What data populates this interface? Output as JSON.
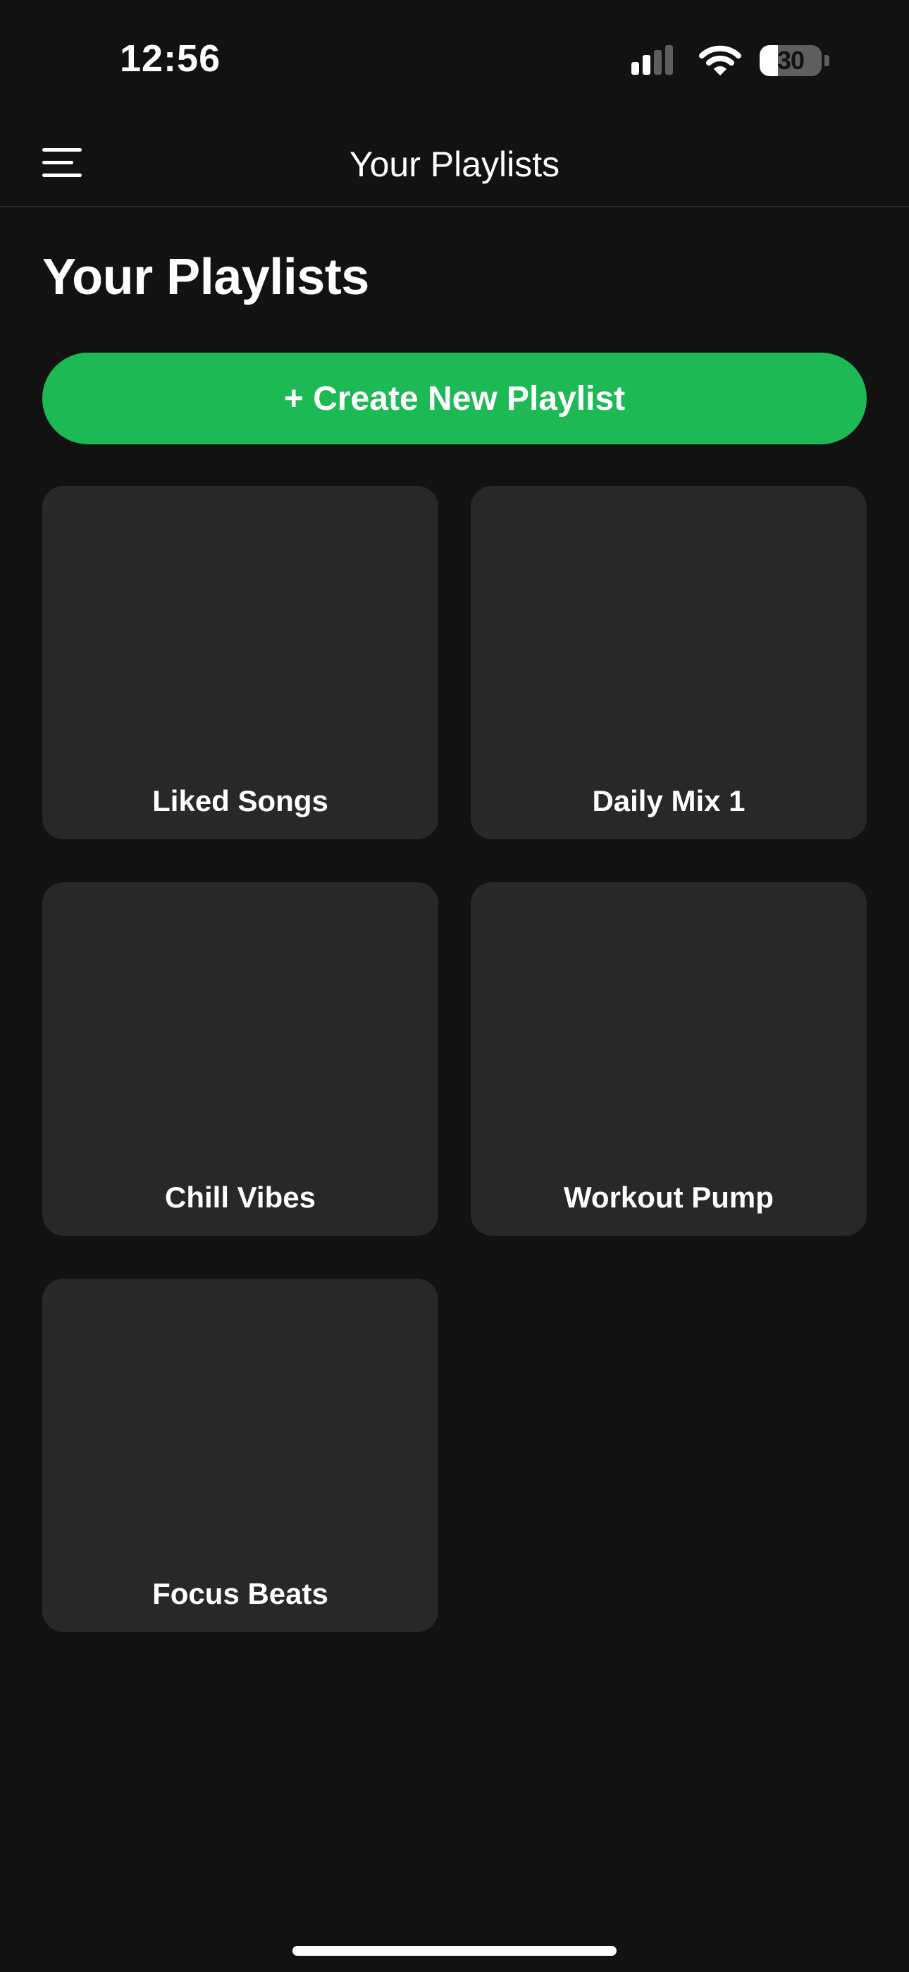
{
  "status_bar": {
    "time": "12:56",
    "battery_level": "30",
    "battery_fraction": 0.3,
    "icons": [
      "signal-icon",
      "wifi-icon",
      "battery-icon"
    ]
  },
  "nav": {
    "title": "Your Playlists",
    "menu_icon": "hamburger-menu-icon"
  },
  "main": {
    "heading": "Your Playlists",
    "create_button_label": "+ Create New Playlist",
    "playlists": [
      {
        "name": "Liked Songs"
      },
      {
        "name": "Daily Mix 1"
      },
      {
        "name": "Chill Vibes"
      },
      {
        "name": "Workout Pump"
      },
      {
        "name": "Focus Beats"
      }
    ]
  },
  "colors": {
    "background": "#121212",
    "card": "#282828",
    "accent": "#1db954",
    "text": "#ffffff"
  }
}
